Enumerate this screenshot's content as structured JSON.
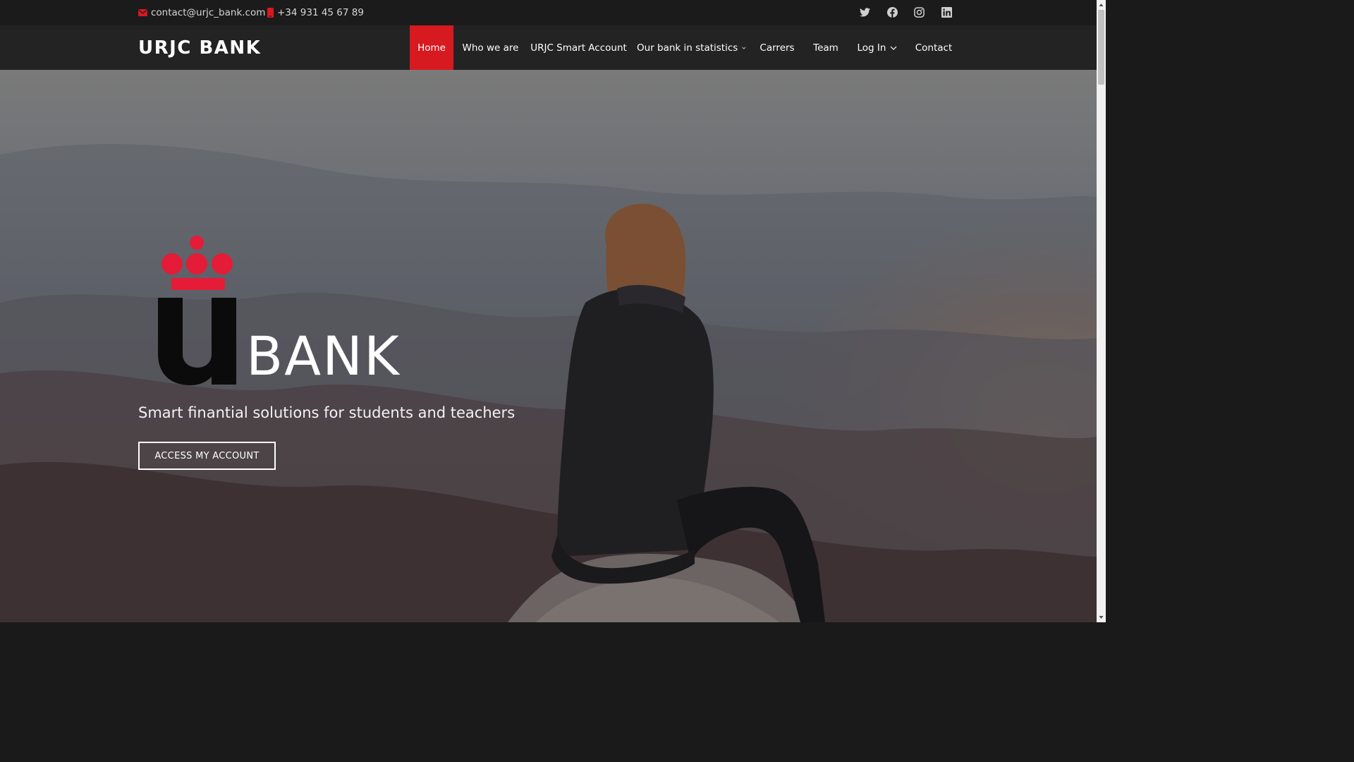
{
  "topbar": {
    "email": "contact@urjc_bank.com",
    "phone": "+34 931 45 67 89",
    "social": [
      "twitter-icon",
      "facebook-icon",
      "instagram-icon",
      "linkedin-icon"
    ]
  },
  "header": {
    "logo": "URJC BANK",
    "nav": [
      {
        "label": "Home",
        "active": true
      },
      {
        "label": "Who we are"
      },
      {
        "label": "URJC Smart Account"
      },
      {
        "label": "Our bank in statistics",
        "dropdown": true
      },
      {
        "label": "Carrers"
      },
      {
        "label": "Team"
      },
      {
        "label": "Log In",
        "dropdown": true
      },
      {
        "label": "Contact"
      }
    ]
  },
  "hero": {
    "brand_word": "BANK",
    "tagline": "Smart finantial solutions for students and teachers",
    "cta": "ACCESS MY ACCOUNT"
  },
  "colors": {
    "accent": "#d71920",
    "topbar_bg": "#1b1b1b",
    "header_bg": "#232323"
  }
}
